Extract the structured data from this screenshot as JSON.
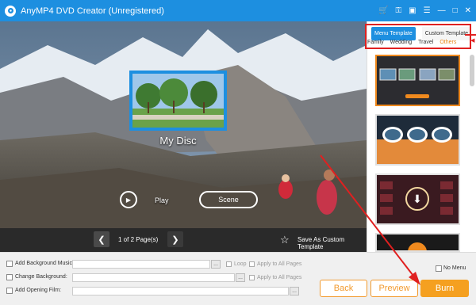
{
  "window": {
    "title": "AnyMP4 DVD Creator (Unregistered)"
  },
  "titlebar_icons": [
    "cart-icon",
    "key-icon",
    "save-icon",
    "menu-icon",
    "minimize-icon",
    "maximize-icon",
    "close-icon"
  ],
  "preview": {
    "disc_title": "My Disc",
    "play_label": "Play",
    "scene_label": "Scene"
  },
  "pager": {
    "page_text": "1 of 2 Page(s)",
    "save_custom_label": "Save As Custom Template"
  },
  "template_panel": {
    "tabs": [
      "Menu Template",
      "Custom Template"
    ],
    "active_tab": "Menu Template",
    "categories": [
      "Family",
      "Wedding",
      "Travel",
      "Others"
    ],
    "active_category": "Others"
  },
  "options": {
    "background_music_label": "Add Background Music:",
    "background_music_value": "",
    "loop_label": "Loop",
    "apply_all_label": "Apply to All Pages",
    "change_background_label": "Change Background:",
    "change_background_value": "",
    "opening_film_label": "Add Opening Film:",
    "opening_film_value": "",
    "browse_label": "...",
    "no_menu_label": "No Menu"
  },
  "buttons": {
    "back": "Back",
    "preview": "Preview",
    "burn": "Burn"
  },
  "colors": {
    "accent_blue": "#1d8fe0",
    "accent_orange": "#f5a020",
    "highlight_red": "#e02020"
  }
}
